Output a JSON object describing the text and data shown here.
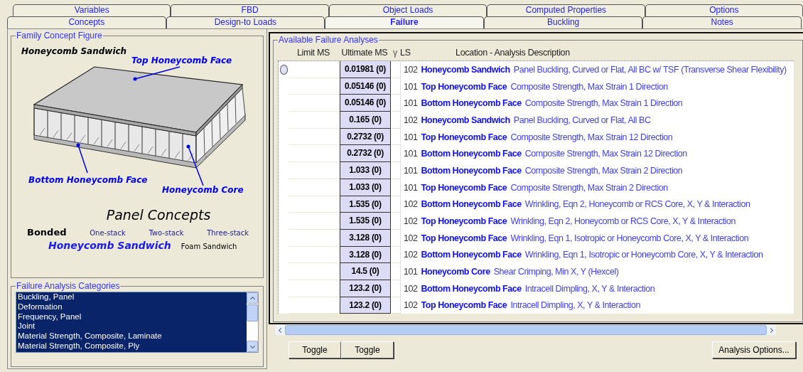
{
  "tabs": {
    "rows": [
      [
        {
          "label": "Variables",
          "selected": false
        },
        {
          "label": "FBD",
          "selected": false
        },
        {
          "label": "Object Loads",
          "selected": false
        },
        {
          "label": "Computed Properties",
          "selected": false
        },
        {
          "label": "Options",
          "selected": false
        }
      ],
      [
        {
          "label": "Concepts",
          "selected": false
        },
        {
          "label": "Design-to Loads",
          "selected": false
        },
        {
          "label": "Failure",
          "selected": true
        },
        {
          "label": "Buckling",
          "selected": false
        },
        {
          "label": "Notes",
          "selected": false
        }
      ]
    ]
  },
  "concept_figure": {
    "title": "Family Concept Figure",
    "family": "Honeycomb Sandwich",
    "callouts": [
      {
        "label": "Top Honeycomb Face"
      },
      {
        "label": "Bottom Honeycomb Face"
      },
      {
        "label": "Honeycomb Core"
      }
    ],
    "panel_concepts": {
      "heading": "Panel Concepts",
      "rows": [
        {
          "kind": "construction",
          "items": [
            {
              "label": "Bonded",
              "selected": true
            },
            {
              "label": "One-stack",
              "selected": false
            },
            {
              "label": "Two-stack",
              "selected": false
            },
            {
              "label": "Three-stack",
              "selected": false
            }
          ]
        },
        {
          "kind": "family",
          "items": [
            {
              "label": "Honeycomb Sandwich",
              "selected": true
            },
            {
              "label": "Foam Sandwich",
              "selected": false
            }
          ]
        }
      ]
    }
  },
  "categories": {
    "title": "Failure Analysis Categories",
    "items": [
      {
        "label": "Buckling, Panel",
        "selected": true
      },
      {
        "label": "Deformation",
        "selected": true
      },
      {
        "label": "Frequency, Panel",
        "selected": true
      },
      {
        "label": "Joint",
        "selected": true
      },
      {
        "label": "Material Strength, Composite, Laminate",
        "selected": true
      },
      {
        "label": "Material Strength, Composite, Ply",
        "selected": true
      }
    ]
  },
  "analyses": {
    "title": "Available Failure Analyses",
    "columns": [
      "Limit MS",
      "Ultimate MS",
      "γ",
      "LS",
      "Location - Analysis Description"
    ],
    "rows": [
      {
        "current": true,
        "ultimate_ms": "0.01981 (0)",
        "ls": "102",
        "location": "Honeycomb Sandwich",
        "description": "Panel Buckling, Curved or Flat, All BC w/ TSF (Transverse Shear Flexibility)"
      },
      {
        "current": false,
        "ultimate_ms": "0.05146 (0)",
        "ls": "101",
        "location": "Top Honeycomb Face",
        "description": "Composite Strength, Max Strain 1 Direction"
      },
      {
        "current": false,
        "ultimate_ms": "0.05146 (0)",
        "ls": "101",
        "location": "Bottom Honeycomb Face",
        "description": "Composite Strength, Max Strain 1 Direction"
      },
      {
        "current": false,
        "ultimate_ms": "0.165 (0)",
        "ls": "102",
        "location": "Honeycomb Sandwich",
        "description": "Panel Buckling, Curved or Flat, All BC"
      },
      {
        "current": false,
        "ultimate_ms": "0.2732 (0)",
        "ls": "101",
        "location": "Top Honeycomb Face",
        "description": "Composite Strength, Max Strain 12 Direction"
      },
      {
        "current": false,
        "ultimate_ms": "0.2732 (0)",
        "ls": "101",
        "location": "Bottom Honeycomb Face",
        "description": "Composite Strength, Max Strain 12 Direction"
      },
      {
        "current": false,
        "ultimate_ms": "1.033 (0)",
        "ls": "101",
        "location": "Bottom Honeycomb Face",
        "description": "Composite Strength, Max Strain 2 Direction"
      },
      {
        "current": false,
        "ultimate_ms": "1.033 (0)",
        "ls": "101",
        "location": "Top Honeycomb Face",
        "description": "Composite Strength, Max Strain 2 Direction"
      },
      {
        "current": false,
        "ultimate_ms": "1.535 (0)",
        "ls": "102",
        "location": "Bottom Honeycomb Face",
        "description": "Wrinkling, Eqn 2, Honeycomb or RCS Core, X, Y & Interaction"
      },
      {
        "current": false,
        "ultimate_ms": "1.535 (0)",
        "ls": "102",
        "location": "Top Honeycomb Face",
        "description": "Wrinkling, Eqn 2, Honeycomb or RCS Core, X, Y & Interaction"
      },
      {
        "current": false,
        "ultimate_ms": "3.128 (0)",
        "ls": "102",
        "location": "Top Honeycomb Face",
        "description": "Wrinkling, Eqn 1, Isotropic or Honeycomb Core, X, Y & Interaction"
      },
      {
        "current": false,
        "ultimate_ms": "3.128 (0)",
        "ls": "102",
        "location": "Bottom Honeycomb Face",
        "description": "Wrinkling, Eqn 1, Isotropic or Honeycomb Core, X, Y & Interaction"
      },
      {
        "current": false,
        "ultimate_ms": "14.5 (0)",
        "ls": "101",
        "location": "Honeycomb Core",
        "description": "Shear Crimping, Min X, Y (Hexcel)"
      },
      {
        "current": false,
        "ultimate_ms": "123.2 (0)",
        "ls": "102",
        "location": "Bottom Honeycomb Face",
        "description": "Intracell Dimpling, X, Y & Interaction"
      },
      {
        "current": false,
        "ultimate_ms": "123.2 (0)",
        "ls": "102",
        "location": "Top Honeycomb Face",
        "description": "Intracell Dimpling, X, Y & Interaction"
      }
    ]
  },
  "buttons": [
    {
      "label": "Toggle"
    },
    {
      "label": "Toggle"
    },
    {
      "label": "Analysis Options..."
    }
  ]
}
